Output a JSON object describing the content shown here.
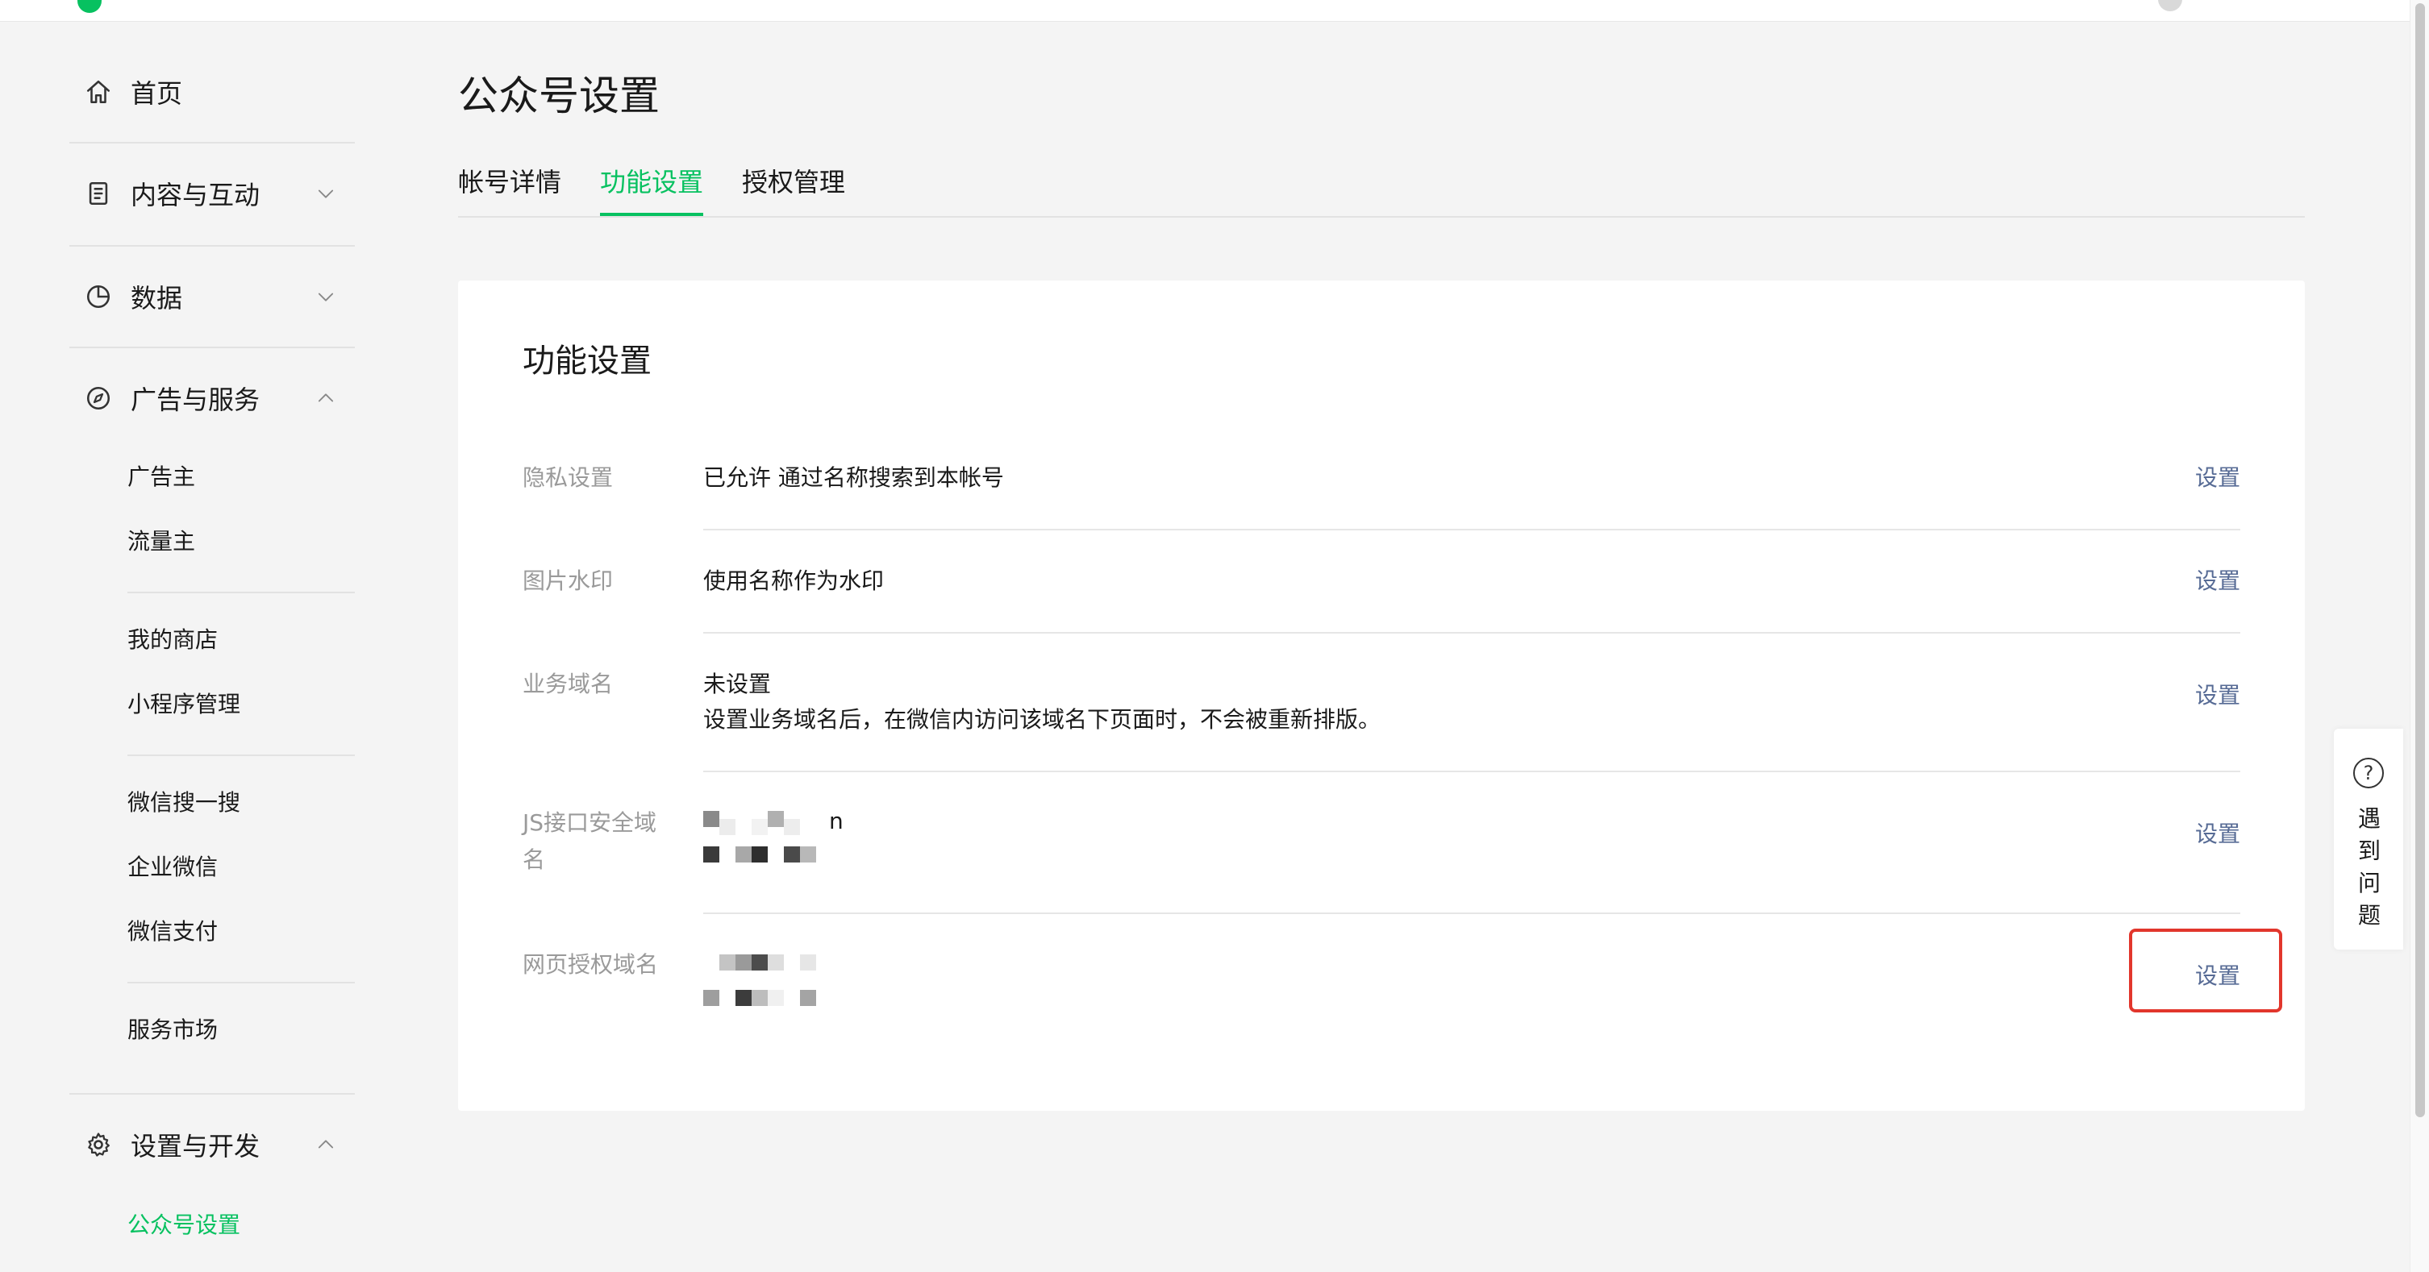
{
  "sidebar": {
    "home": "首页",
    "content": "内容与互动",
    "data": "数据",
    "ads": "广告与服务",
    "advertiser": "广告主",
    "publisher": "流量主",
    "my_store": "我的商店",
    "mini_program": "小程序管理",
    "wechat_search": "微信搜一搜",
    "wecom": "企业微信",
    "wechat_pay": "微信支付",
    "service_market": "服务市场",
    "settings_dev": "设置与开发",
    "account_settings": "公众号设置"
  },
  "page": {
    "title": "公众号设置",
    "tabs": [
      {
        "label": "帐号详情",
        "active": false
      },
      {
        "label": "功能设置",
        "active": true
      },
      {
        "label": "授权管理",
        "active": false
      }
    ]
  },
  "card": {
    "title": "功能设置",
    "rows": [
      {
        "label": "隐私设置",
        "value": "已允许 通过名称搜索到本帐号",
        "action": "设置"
      },
      {
        "label": "图片水印",
        "value": "使用名称作为水印",
        "action": "设置"
      },
      {
        "label": "业务域名",
        "value": "未设置",
        "note": "设置业务域名后，在微信内访问该域名下页面时，不会被重新排版。",
        "action": "设置"
      },
      {
        "label": "JS接口安全域名",
        "value_suffix": "n",
        "action": "设置"
      },
      {
        "label": "网页授权域名",
        "action": "设置"
      }
    ]
  },
  "help": {
    "icon": "?",
    "label": "遇到问题"
  },
  "colors": {
    "accent": "#07c160",
    "link": "#576b95",
    "highlight": "#e2362c"
  }
}
